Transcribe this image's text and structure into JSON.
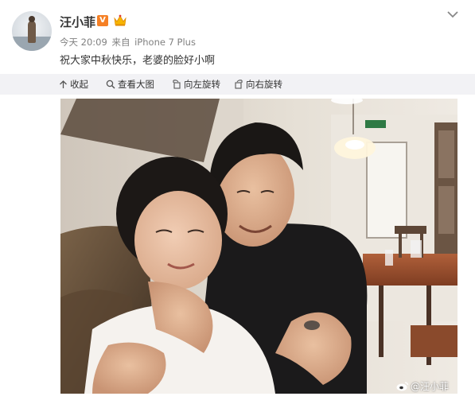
{
  "post": {
    "username": "汪小菲",
    "verified_badge": "V",
    "time": "今天 20:09",
    "source_prefix": "来自",
    "source_device": "iPhone 7 Plus",
    "text": "祝大家中秋快乐，老婆的脸好小啊"
  },
  "toolbar": {
    "collapse": "收起",
    "view_large": "查看大图",
    "rotate_left": "向左旋转",
    "rotate_right": "向右旋转"
  },
  "photo": {
    "watermark": "@汪小菲"
  },
  "colors": {
    "verified_badge": "#f58025",
    "toolbar_bg": "#f2f2f5",
    "meta_text": "#808080"
  },
  "icons": [
    "chevron-down-icon",
    "vip-crown-icon",
    "collapse-arrow-icon",
    "magnifier-icon",
    "rotate-left-icon",
    "rotate-right-icon",
    "weibo-logo-icon"
  ]
}
